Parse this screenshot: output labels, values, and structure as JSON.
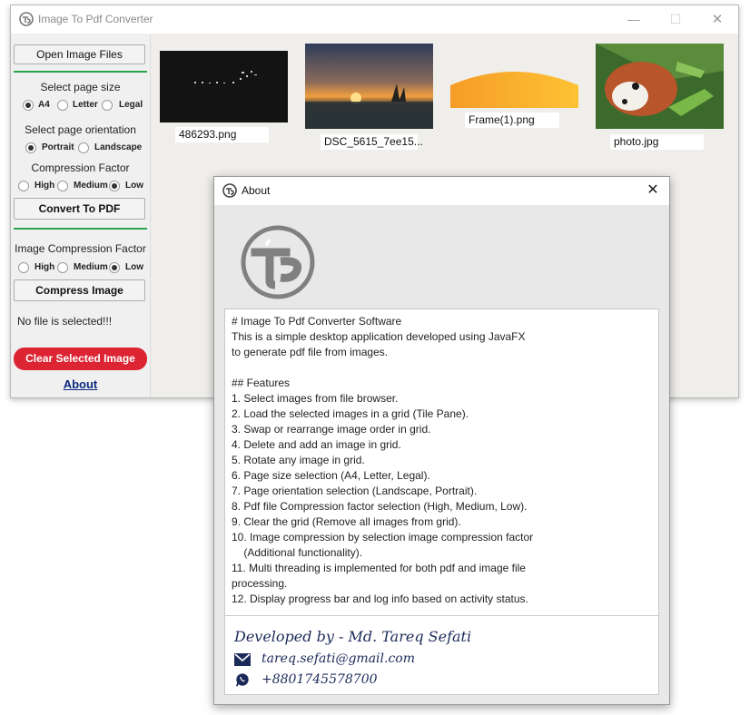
{
  "window": {
    "title": "Image To Pdf Converter",
    "min_glyph": "—",
    "max_glyph": "☐",
    "close_glyph": "✕"
  },
  "sidebar": {
    "open_button": "Open Image Files",
    "page_size_label": "Select page size",
    "page_sizes": [
      {
        "label": "A4",
        "selected": true
      },
      {
        "label": "Letter",
        "selected": false
      },
      {
        "label": "Legal",
        "selected": false
      }
    ],
    "orientation_label": "Select page orientation",
    "orientations": [
      {
        "label": "Portrait",
        "selected": true
      },
      {
        "label": "Landscape",
        "selected": false
      }
    ],
    "compression_label": "Compression Factor",
    "compression": [
      {
        "label": "High",
        "selected": false
      },
      {
        "label": "Medium",
        "selected": false
      },
      {
        "label": "Low",
        "selected": true
      }
    ],
    "convert_button": "Convert To PDF",
    "image_compression_label": "Image Compression Factor",
    "image_compression": [
      {
        "label": "High",
        "selected": false
      },
      {
        "label": "Medium",
        "selected": false
      },
      {
        "label": "Low",
        "selected": true
      }
    ],
    "compress_button": "Compress Image",
    "status": "No file is selected!!!",
    "clear_button": "Clear Selected Image",
    "about_link": "About"
  },
  "images": [
    {
      "name": "486293.png"
    },
    {
      "name": "DSC_5615_7ee15..."
    },
    {
      "name": "Frame(1).png"
    },
    {
      "name": "photo.jpg"
    }
  ],
  "about": {
    "title": "About",
    "close_glyph": "✕",
    "description": "# Image To Pdf Converter Software\nThis is a simple desktop application developed using JavaFX\nto generate pdf file from images.\n\n## Features\n1. Select images from file browser.\n2. Load the selected images in a grid (Tile Pane).\n3. Swap or rearrange image order in grid.\n4. Delete and add an image in grid.\n5. Rotate any image in grid.\n6. Page size selection (A4, Letter, Legal).\n7. Page orientation selection (Landscape, Portrait).\n8. Pdf file Compression factor selection (High, Medium, Low).\n9. Clear the grid (Remove all images from grid).\n10. Image compression by selection image compression factor\n    (Additional functionality).\n11. Multi threading is implemented for both pdf and image file\nprocessing.\n12. Display progress bar and log info based on activity status.",
    "developer": "Developed by - Md. Tareq Sefati",
    "email": "tareq.sefati@gmail.com",
    "phone": "+8801745578700"
  },
  "colors": {
    "accent_green": "#2aa34a",
    "clear_red": "#dc2432",
    "link_blue": "#0a2a80",
    "dev_text": "#1c2a5a"
  }
}
